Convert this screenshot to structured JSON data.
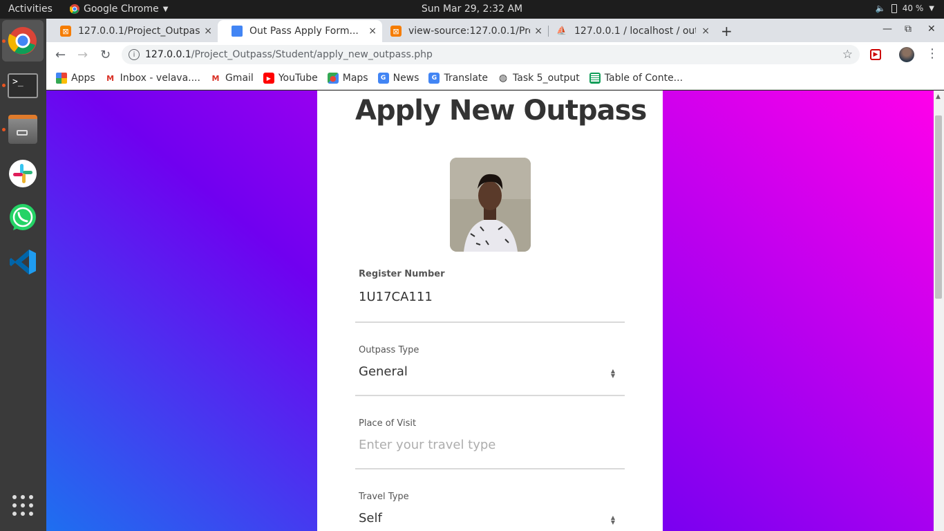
{
  "topbar": {
    "activities": "Activities",
    "app_name": "Google Chrome",
    "clock": "Sun Mar 29,  2:32 AM",
    "battery": "40 %"
  },
  "dock": {
    "items": [
      "chrome",
      "terminal",
      "files",
      "slack",
      "whatsapp",
      "vscode",
      "show-apps"
    ]
  },
  "browser": {
    "tabs": [
      {
        "title": "127.0.0.1/Project_Outpass",
        "close": "×"
      },
      {
        "title": "Out Pass Apply Form...",
        "close": "×"
      },
      {
        "title": "view-source:127.0.0.1/Pro",
        "close": "×"
      },
      {
        "title": "127.0.0.1 / localhost / outp",
        "close": "×"
      }
    ],
    "new_tab": "+",
    "url_host": "127.0.0.1",
    "url_path": "/Project_Outpass/Student/apply_new_outpass.php",
    "bookmarks": [
      "Apps",
      "Inbox - velava....",
      "Gmail",
      "YouTube",
      "Maps",
      "News",
      "Translate",
      "Task 5_output",
      "Table of Conte..."
    ]
  },
  "form": {
    "title": "Apply New Outpass",
    "register_label": "Register Number",
    "register_value": "1U17CA111",
    "outpass_type_label": "Outpass Type",
    "outpass_type_value": "General",
    "place_label": "Place of Visit",
    "place_placeholder": "Enter your travel type",
    "travel_type_label": "Travel Type",
    "travel_type_value": "Self"
  },
  "colors": {
    "gradient_top_right": "#ff00ea",
    "gradient_bottom_left": "#1e6ff0",
    "card_bg": "#ffffff",
    "title_color": "#333333"
  }
}
